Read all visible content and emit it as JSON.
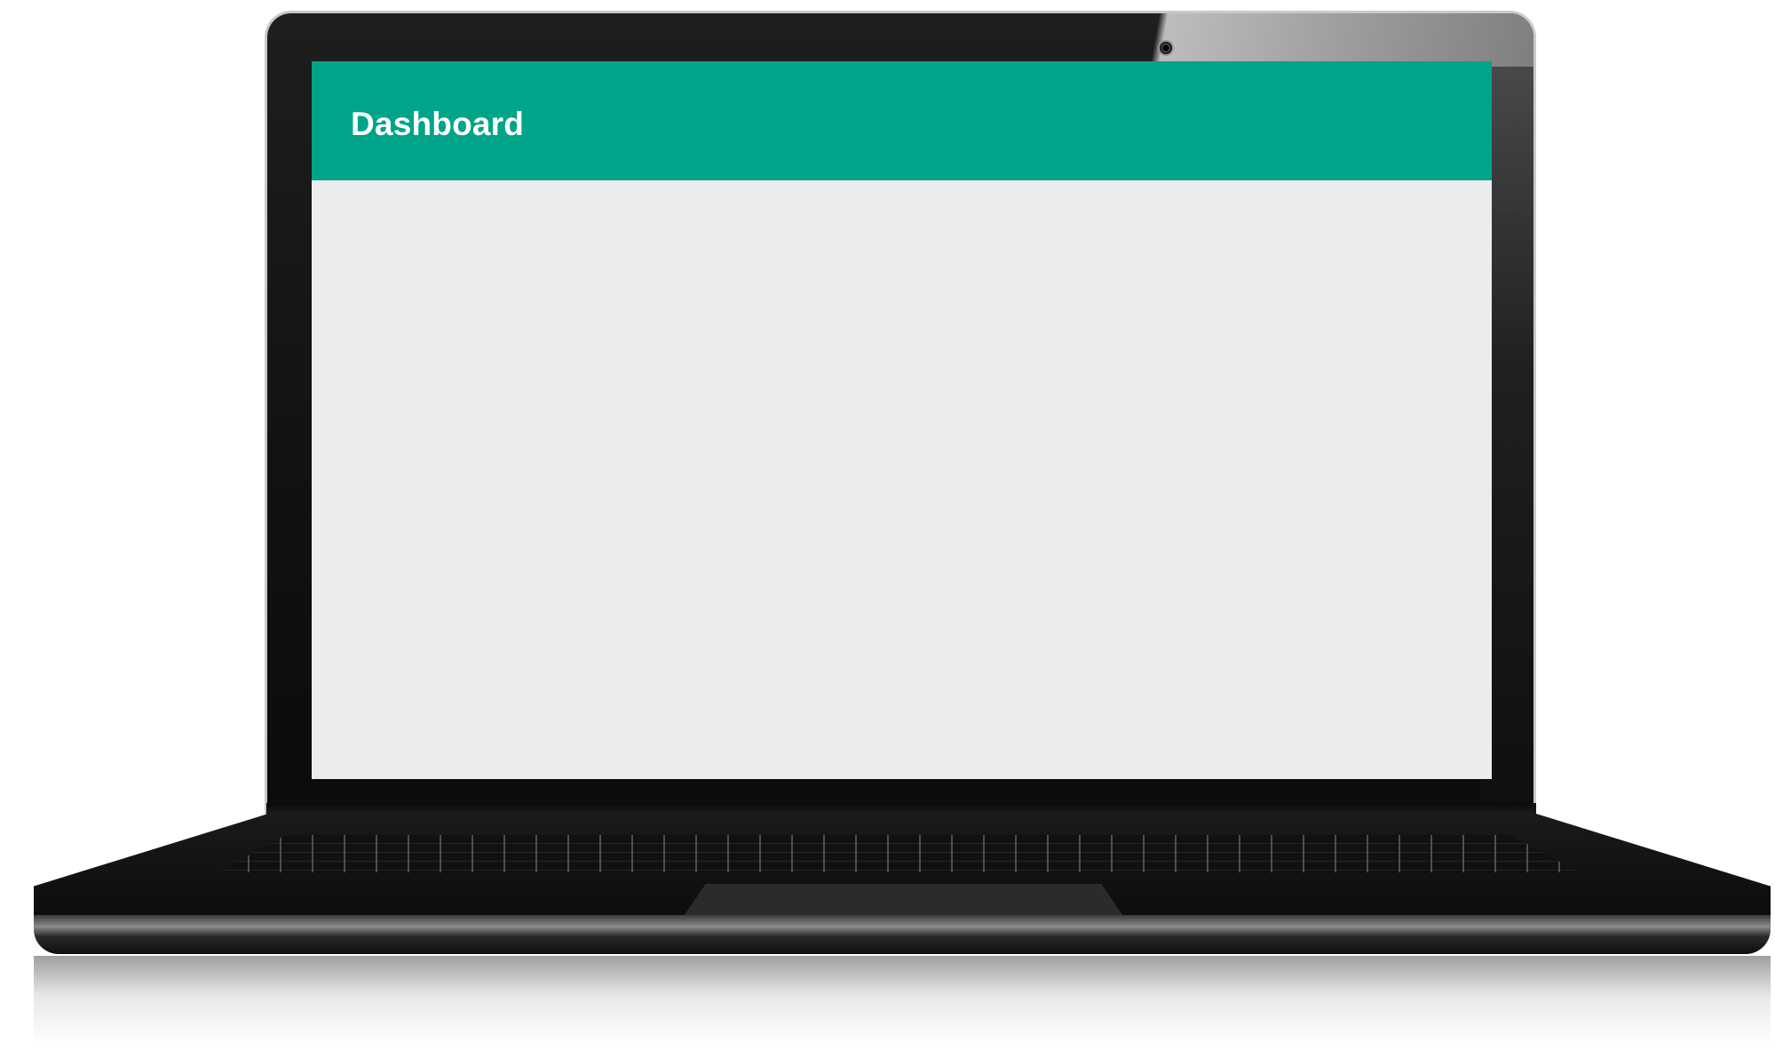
{
  "app": {
    "title": "Dashboard"
  },
  "colors": {
    "header_accent": "#00a488",
    "content_background": "#ebecee",
    "header_text": "#ffffff"
  },
  "device": {
    "icons": [
      "camera-icon"
    ]
  }
}
